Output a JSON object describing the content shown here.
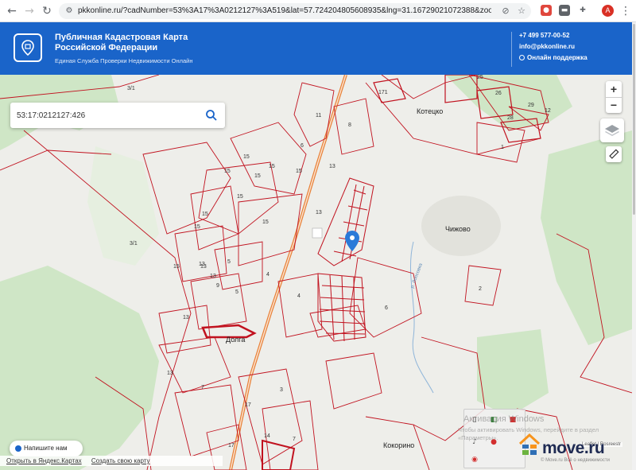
{
  "browser": {
    "url": "pkkonline.ru/?cadNumber=53%3A17%3A0212127%3A519&lat=57.724204805608935&lng=31.16729021072388&zoom=15"
  },
  "header": {
    "title": "Публичная Кадастровая Карта Российской Федерации",
    "subtitle": "Единая Служба Проверки Недвижимости Онлайн",
    "phone": "+7 499 577-00-52",
    "email": "info@pkkonline.ru",
    "support": "Онлайн поддержка"
  },
  "search": {
    "value": "53:17:0212127:426"
  },
  "map": {
    "places": {
      "kotetsko": "Котецко",
      "chizhovo": "Чижово",
      "dolga": "Долга",
      "kokorino": "Кокорино"
    },
    "plots": [
      "3/1",
      "3/1",
      "11",
      "8",
      "6",
      "15",
      "15",
      "15",
      "15",
      "15",
      "15",
      "15",
      "15",
      "13",
      "13",
      "13",
      "15",
      "15",
      "13",
      "13",
      "5",
      "9",
      "5",
      "4",
      "4",
      "6",
      "2",
      "13",
      "7",
      "17",
      "3",
      "14",
      "7",
      "171",
      "26",
      "25",
      "28",
      "29",
      "12",
      "1",
      "17",
      "13"
    ],
    "stream": "р. Лопсовка",
    "chat": "Напишите нам",
    "attrib_open": "Открыть в Яндекс.Картах",
    "attrib_create": "Создать свою карту",
    "leaflet": "Leaflet | Rosreestr",
    "watermark": "Активация Windows",
    "watermark_sub": "Чтобы активировать Windows, перейдите в раздел «Параметры».",
    "moveru": "move.ru",
    "moveru_sub": "© Move.ru Всё о недвижимости"
  },
  "colors": {
    "header_blue": "#1a64c9",
    "plot_red": "#c1121f",
    "forest": "#cfe6c6",
    "road": "#e8823a"
  }
}
